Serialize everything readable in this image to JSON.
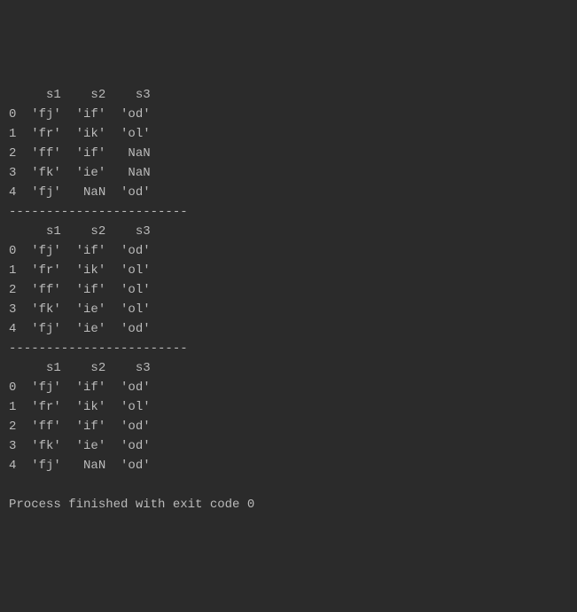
{
  "tables": [
    {
      "header": [
        "",
        "s1",
        "s2",
        "s3"
      ],
      "rows": [
        [
          "0",
          "'fj'",
          "'if'",
          "'od'"
        ],
        [
          "1",
          "'fr'",
          "'ik'",
          "'ol'"
        ],
        [
          "2",
          "'ff'",
          "'if'",
          "NaN"
        ],
        [
          "3",
          "'fk'",
          "'ie'",
          "NaN"
        ],
        [
          "4",
          "'fj'",
          "NaN",
          "'od'"
        ]
      ]
    },
    {
      "header": [
        "",
        "s1",
        "s2",
        "s3"
      ],
      "rows": [
        [
          "0",
          "'fj'",
          "'if'",
          "'od'"
        ],
        [
          "1",
          "'fr'",
          "'ik'",
          "'ol'"
        ],
        [
          "2",
          "'ff'",
          "'if'",
          "'ol'"
        ],
        [
          "3",
          "'fk'",
          "'ie'",
          "'ol'"
        ],
        [
          "4",
          "'fj'",
          "'ie'",
          "'od'"
        ]
      ]
    },
    {
      "header": [
        "",
        "s1",
        "s2",
        "s3"
      ],
      "rows": [
        [
          "0",
          "'fj'",
          "'if'",
          "'od'"
        ],
        [
          "1",
          "'fr'",
          "'ik'",
          "'ol'"
        ],
        [
          "2",
          "'ff'",
          "'if'",
          "'od'"
        ],
        [
          "3",
          "'fk'",
          "'ie'",
          "'od'"
        ],
        [
          "4",
          "'fj'",
          "NaN",
          "'od'"
        ]
      ]
    }
  ],
  "separator": "------------------------",
  "exit_message": "Process finished with exit code 0",
  "chart_data": [
    {
      "type": "table",
      "title": "DataFrame 1",
      "columns": [
        "s1",
        "s2",
        "s3"
      ],
      "index": [
        0,
        1,
        2,
        3,
        4
      ],
      "data": [
        [
          "fj",
          "if",
          "od"
        ],
        [
          "fr",
          "ik",
          "ol"
        ],
        [
          "ff",
          "if",
          null
        ],
        [
          "fk",
          "ie",
          null
        ],
        [
          "fj",
          null,
          "od"
        ]
      ]
    },
    {
      "type": "table",
      "title": "DataFrame 2",
      "columns": [
        "s1",
        "s2",
        "s3"
      ],
      "index": [
        0,
        1,
        2,
        3,
        4
      ],
      "data": [
        [
          "fj",
          "if",
          "od"
        ],
        [
          "fr",
          "ik",
          "ol"
        ],
        [
          "ff",
          "if",
          "ol"
        ],
        [
          "fk",
          "ie",
          "ol"
        ],
        [
          "fj",
          "ie",
          "od"
        ]
      ]
    },
    {
      "type": "table",
      "title": "DataFrame 3",
      "columns": [
        "s1",
        "s2",
        "s3"
      ],
      "index": [
        0,
        1,
        2,
        3,
        4
      ],
      "data": [
        [
          "fj",
          "if",
          "od"
        ],
        [
          "fr",
          "ik",
          "ol"
        ],
        [
          "ff",
          "if",
          "od"
        ],
        [
          "fk",
          "ie",
          "od"
        ],
        [
          "fj",
          null,
          "od"
        ]
      ]
    }
  ]
}
